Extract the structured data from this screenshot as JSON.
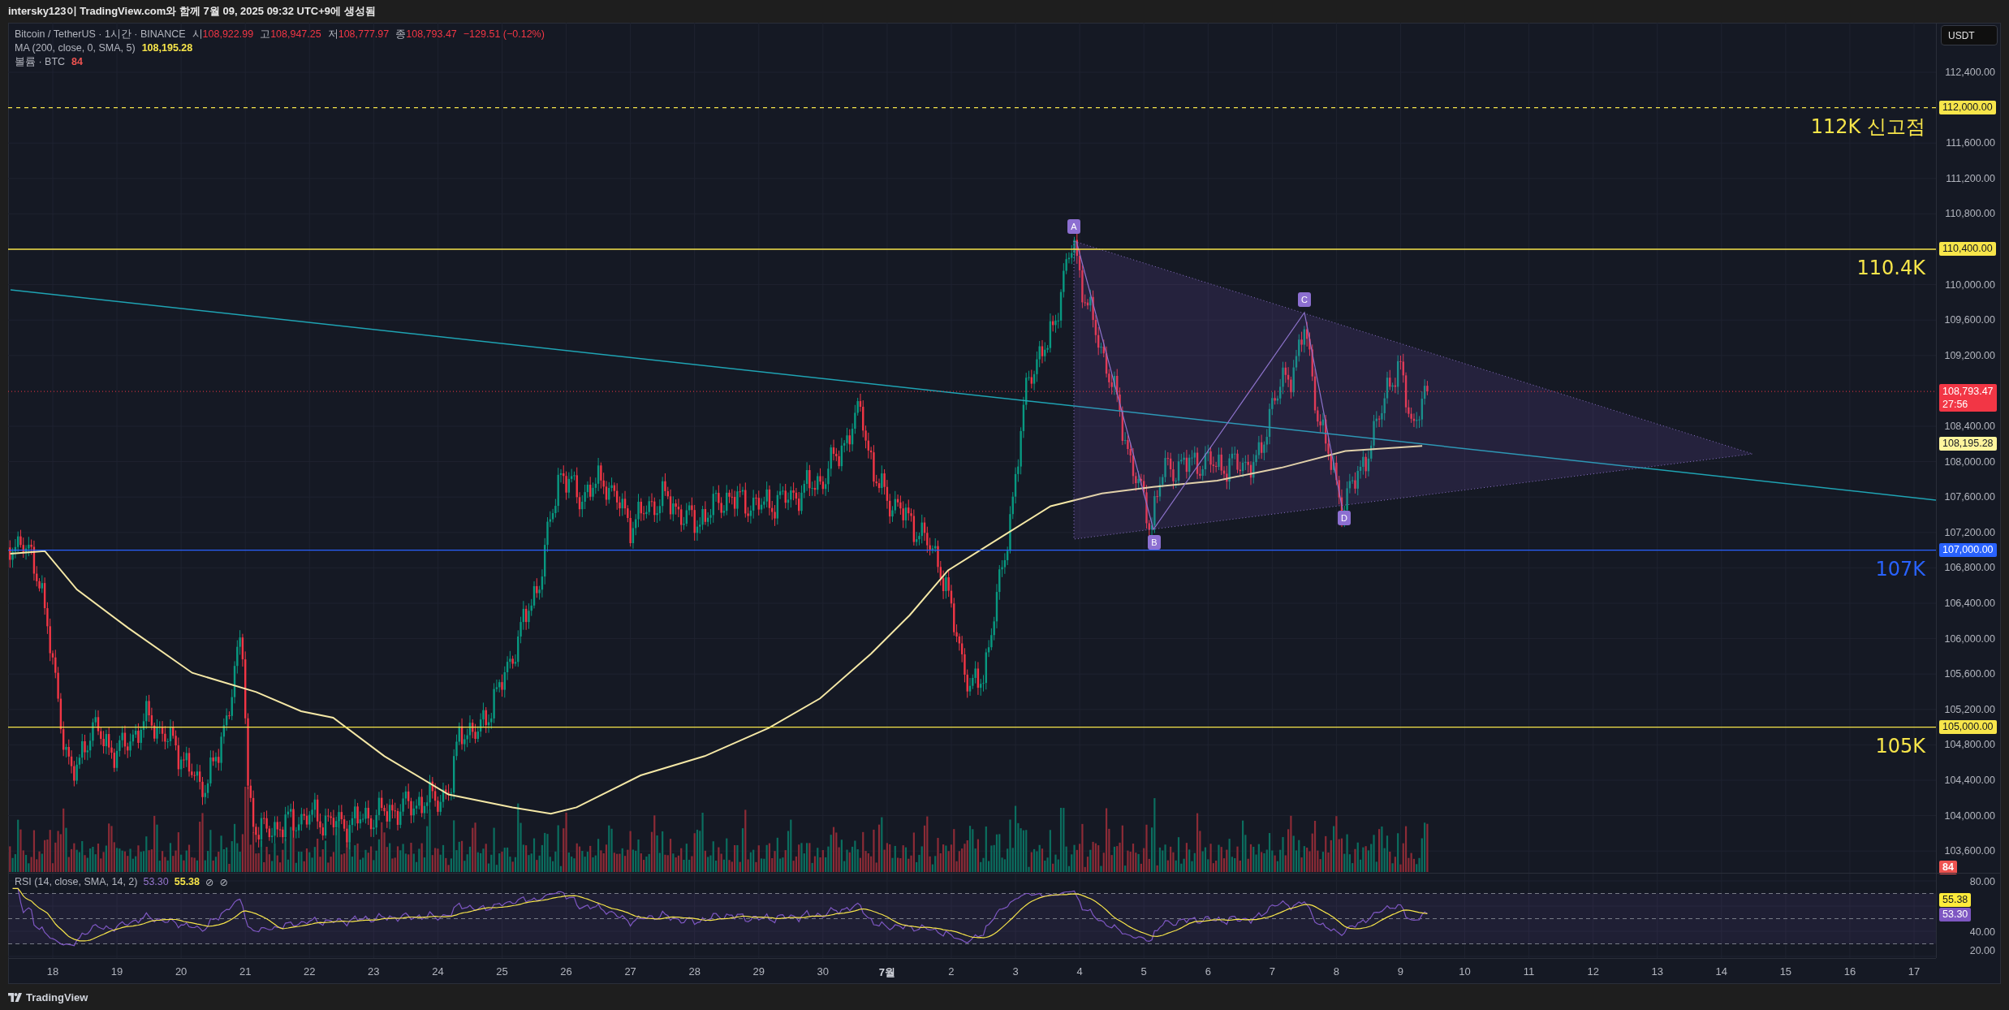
{
  "header": {
    "title": "intersky123이 TradingView.com와 함께 7월 09, 2025 09:32 UTC+9에 생성됨"
  },
  "legend": {
    "symbol": "Bitcoin / TetherUS · 1시간 · BINANCE",
    "ohlc": [
      {
        "label": "시",
        "value": "108,922.99"
      },
      {
        "label": "고",
        "value": "108,947.25"
      },
      {
        "label": "저",
        "value": "108,777.97"
      },
      {
        "label": "종",
        "value": "108,793.47"
      }
    ],
    "change": "−129.51 (−0.12%)"
  },
  "indicators": [
    {
      "name": "MA (200, close, 0, SMA, 5)",
      "value": "108,195.28",
      "color": "#f7e54a"
    },
    {
      "name": "볼륨 · BTC",
      "value": "84",
      "color": "#ef5350"
    }
  ],
  "currency": "USDT",
  "price_axis": [
    "112,400.00",
    "111,600.00",
    "111,200.00",
    "110,800.00",
    "110,000.00",
    "109,600.00",
    "109,200.00",
    "108,400.00",
    "108,000.00",
    "107,600.00",
    "107,200.00",
    "106,800.00",
    "106,400.00",
    "106,000.00",
    "105,600.00",
    "105,200.00",
    "104,800.00",
    "104,400.00",
    "104,000.00",
    "103,600.00"
  ],
  "levels": [
    {
      "price": "112,000.00",
      "label": "112K 신고점",
      "kind": "dashed",
      "color": "#f7e54a"
    },
    {
      "price": "110,400.00",
      "label": "110.4K",
      "kind": "solid",
      "color": "#f7e54a"
    },
    {
      "price": "107,000.00",
      "label": "107K",
      "kind": "solid",
      "color": "#2962ff"
    },
    {
      "price": "105,000.00",
      "label": "105K",
      "kind": "solid",
      "color": "#f7e54a"
    }
  ],
  "last_price": {
    "value": "108,793.47",
    "countdown": "27:56"
  },
  "ma_tag": "108,195.28",
  "volume_tag": "84",
  "pattern_points": [
    "A",
    "B",
    "C",
    "D"
  ],
  "rsi": {
    "name": "RSI (14, close, SMA, 14, 2)",
    "value": "53.30",
    "ma_value": "55.38",
    "icons": [
      "⊘",
      "⊘"
    ],
    "axis": [
      "80.00",
      "40.00",
      "20.00"
    ],
    "tags": [
      {
        "value": "55.38",
        "kind": "average"
      },
      {
        "value": "53.30",
        "kind": "rsi"
      }
    ]
  },
  "date_axis": [
    {
      "label": "18",
      "kind": "day"
    },
    {
      "label": "19",
      "kind": "day"
    },
    {
      "label": "20",
      "kind": "day"
    },
    {
      "label": "21",
      "kind": "day"
    },
    {
      "label": "22",
      "kind": "day"
    },
    {
      "label": "23",
      "kind": "day"
    },
    {
      "label": "24",
      "kind": "day"
    },
    {
      "label": "25",
      "kind": "day"
    },
    {
      "label": "26",
      "kind": "day"
    },
    {
      "label": "27",
      "kind": "day"
    },
    {
      "label": "28",
      "kind": "day"
    },
    {
      "label": "29",
      "kind": "day"
    },
    {
      "label": "30",
      "kind": "day"
    },
    {
      "label": "7월",
      "kind": "month"
    },
    {
      "label": "2",
      "kind": "day"
    },
    {
      "label": "3",
      "kind": "day"
    },
    {
      "label": "4",
      "kind": "day"
    },
    {
      "label": "5",
      "kind": "day"
    },
    {
      "label": "6",
      "kind": "day"
    },
    {
      "label": "7",
      "kind": "day"
    },
    {
      "label": "8",
      "kind": "day"
    },
    {
      "label": "9",
      "kind": "day"
    },
    {
      "label": "10",
      "kind": "day"
    },
    {
      "label": "11",
      "kind": "day"
    },
    {
      "label": "12",
      "kind": "day"
    },
    {
      "label": "13",
      "kind": "day"
    },
    {
      "label": "14",
      "kind": "day"
    },
    {
      "label": "15",
      "kind": "day"
    },
    {
      "label": "16",
      "kind": "day"
    },
    {
      "label": "17",
      "kind": "day"
    }
  ],
  "footer": {
    "brand": "TradingView"
  }
}
